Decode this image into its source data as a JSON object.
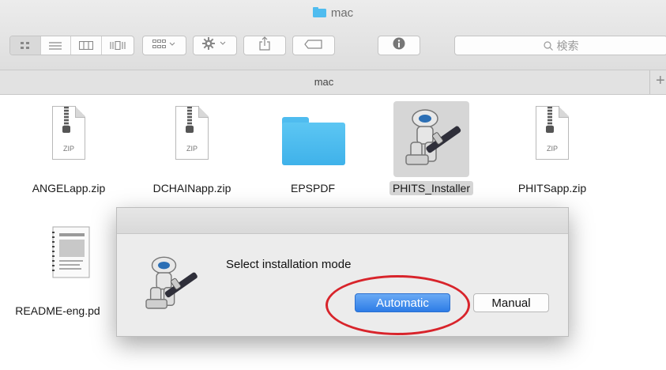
{
  "window": {
    "title": "mac",
    "folder_color": "#4fbcef"
  },
  "toolbar": {
    "view_buttons": [
      "icon-view-icon",
      "list-view-icon",
      "column-view-icon",
      "coverflow-view-icon"
    ],
    "arrange_icon": "arrange-icon",
    "action_icon": "gear-icon",
    "share_icon": "share-icon",
    "tag_icon": "tag-icon",
    "info_icon": "info-icon",
    "search_placeholder": "検索"
  },
  "tabbar": {
    "label": "mac",
    "add_tab": "+"
  },
  "files": [
    {
      "name": "ANGELapp.zip",
      "type": "zip",
      "badge": "ZIP"
    },
    {
      "name": "DCHAINapp.zip",
      "type": "zip",
      "badge": "ZIP"
    },
    {
      "name": "EPSPDF",
      "type": "folder"
    },
    {
      "name": "PHITS_Installer",
      "type": "automator",
      "selected": true
    },
    {
      "name": "PHITSapp.zip",
      "type": "zip",
      "badge": "ZIP"
    },
    {
      "name": "README-eng.pd",
      "type": "pdf"
    }
  ],
  "dialog": {
    "message": "Select installation mode",
    "primary_button": "Automatic",
    "secondary_button": "Manual"
  },
  "colors": {
    "accent": "#2d7ce6",
    "highlight": "#d8242b",
    "selection": "#d6d6d6"
  }
}
